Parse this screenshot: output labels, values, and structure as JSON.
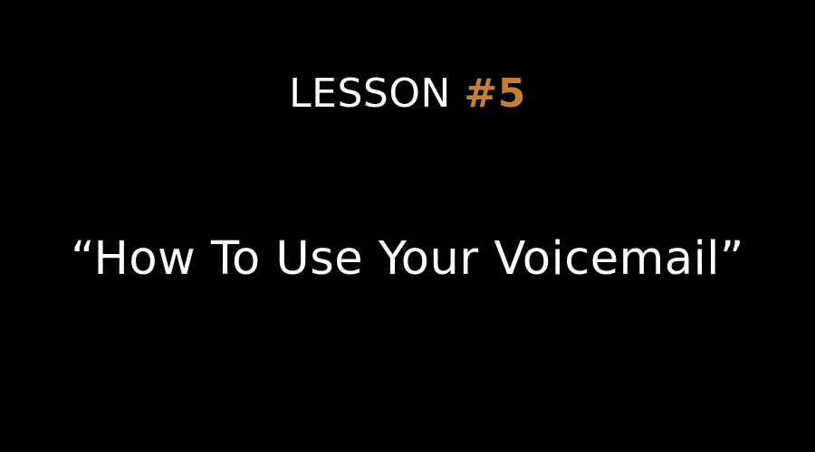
{
  "slide": {
    "heading_label": "LESSON",
    "heading_number": "#5",
    "title": "“How To Use Your Voicemail”"
  },
  "colors": {
    "background": "#000000",
    "text": "#ffffff",
    "accent": "#c67d34"
  }
}
